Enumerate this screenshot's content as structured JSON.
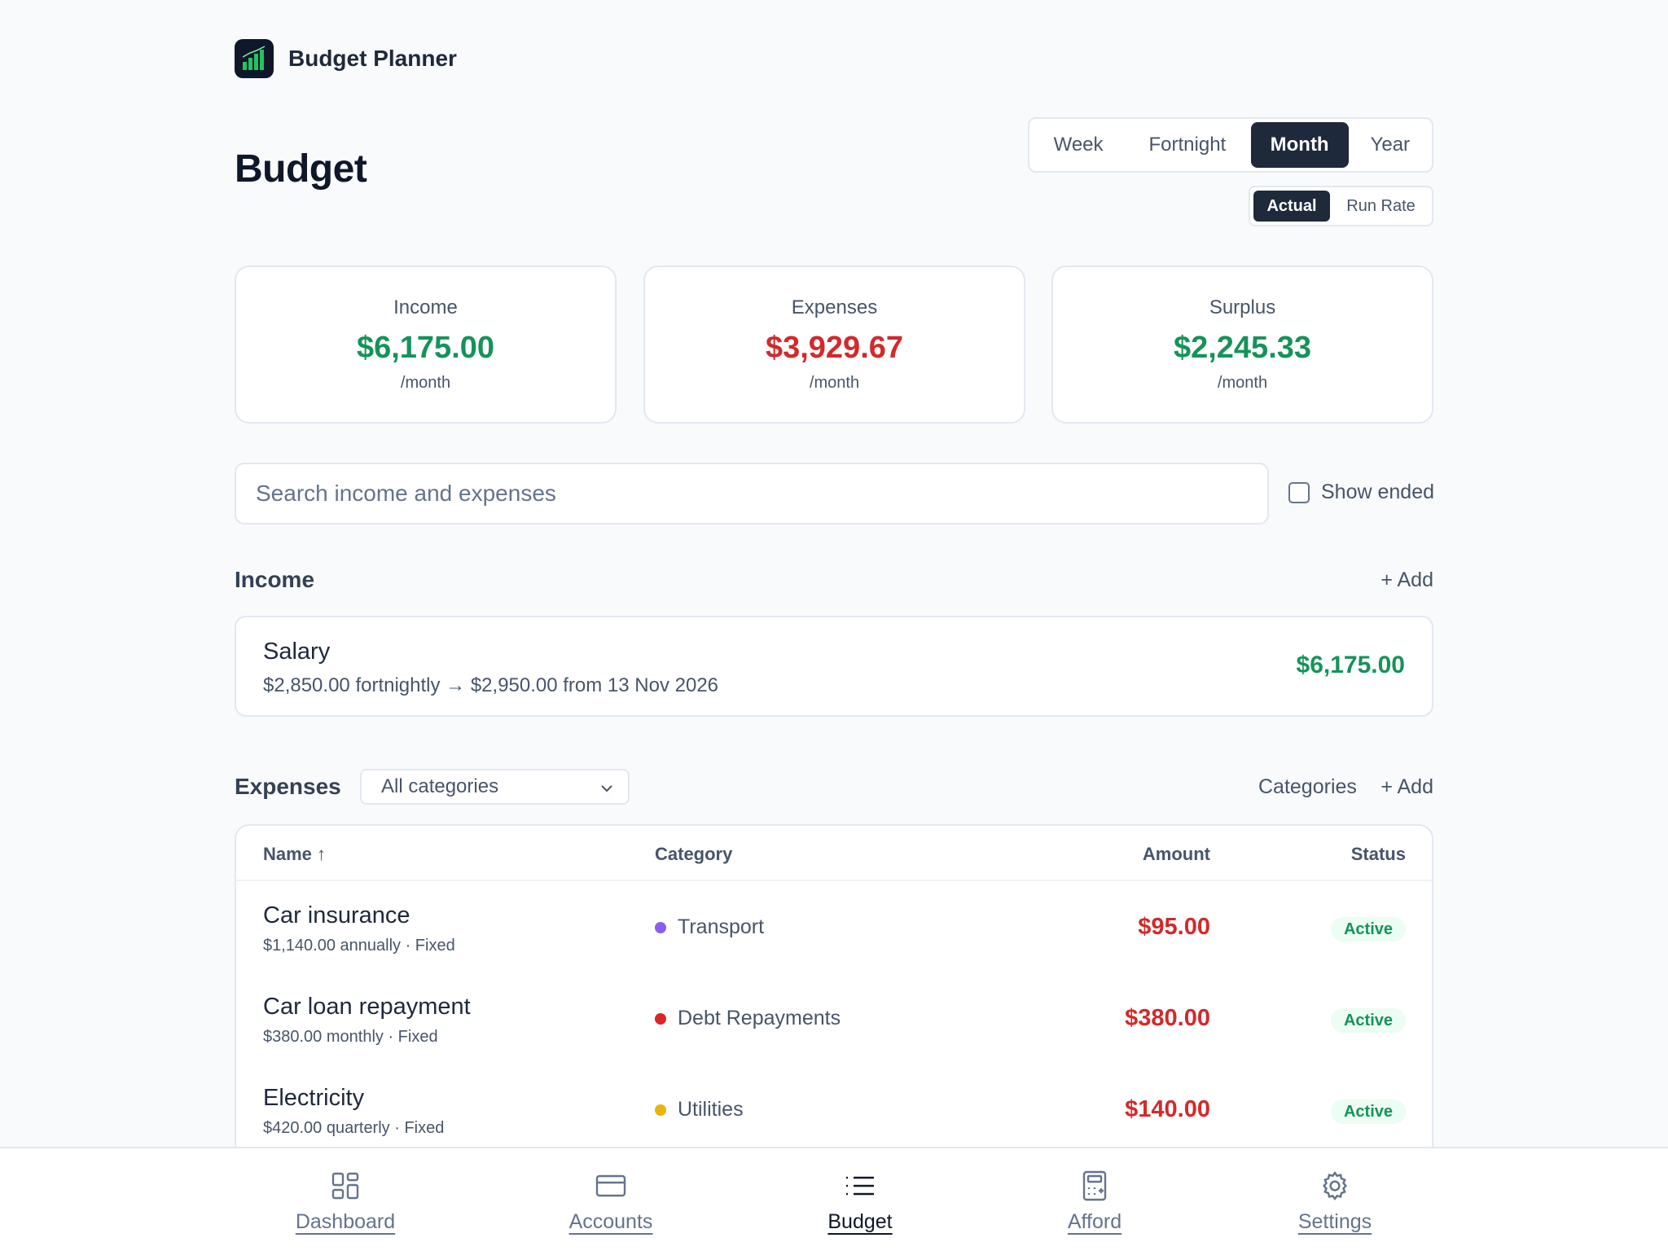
{
  "app": {
    "title": "Budget Planner",
    "logo_icon": "bar-chart-icon"
  },
  "page": {
    "title": "Budget"
  },
  "period": {
    "options": [
      "Week",
      "Fortnight",
      "Month",
      "Year"
    ],
    "selected": "Month"
  },
  "mode": {
    "options": [
      "Actual",
      "Run Rate"
    ],
    "selected": "Actual"
  },
  "summary": [
    {
      "label": "Income",
      "value": "$6,175.00",
      "unit": "/month",
      "color": "#15935a"
    },
    {
      "label": "Expenses",
      "value": "$3,929.67",
      "unit": "/month",
      "color": "#d3292a"
    },
    {
      "label": "Surplus",
      "value": "$2,245.33",
      "unit": "/month",
      "color": "#15935a"
    }
  ],
  "search": {
    "placeholder": "Search income and expenses",
    "value": ""
  },
  "show_ended": {
    "label": "Show ended",
    "checked": false
  },
  "income": {
    "title": "Income",
    "add_label": "+ Add",
    "items": [
      {
        "name": "Salary",
        "detail": "$2,850.00 fortnightly → $2,950.00 from 13 Nov 2026",
        "amount": "$6,175.00"
      }
    ]
  },
  "expenses": {
    "title": "Expenses",
    "filter": {
      "selected": "All categories"
    },
    "categories_label": "Categories",
    "add_label": "+ Add",
    "columns": {
      "name": "Name ↑",
      "category": "Category",
      "amount": "Amount",
      "status": "Status"
    },
    "rows": [
      {
        "name": "Car insurance",
        "sub": "$1,140.00 annually · Fixed",
        "category": "Transport",
        "category_color": "#8b5cf6",
        "amount": "$95.00",
        "status": "Active"
      },
      {
        "name": "Car loan repayment",
        "sub": "$380.00 monthly · Fixed",
        "category": "Debt Repayments",
        "category_color": "#dc2626",
        "amount": "$380.00",
        "status": "Active"
      },
      {
        "name": "Electricity",
        "sub": "$420.00 quarterly · Fixed",
        "category": "Utilities",
        "category_color": "#eab308",
        "amount": "$140.00",
        "status": "Active"
      }
    ]
  },
  "nav": {
    "items": [
      {
        "label": "Dashboard",
        "icon": "dashboard-icon"
      },
      {
        "label": "Accounts",
        "icon": "card-icon"
      },
      {
        "label": "Budget",
        "icon": "list-icon"
      },
      {
        "label": "Afford",
        "icon": "calculator-icon"
      },
      {
        "label": "Settings",
        "icon": "gear-icon"
      }
    ],
    "active": "Budget"
  }
}
